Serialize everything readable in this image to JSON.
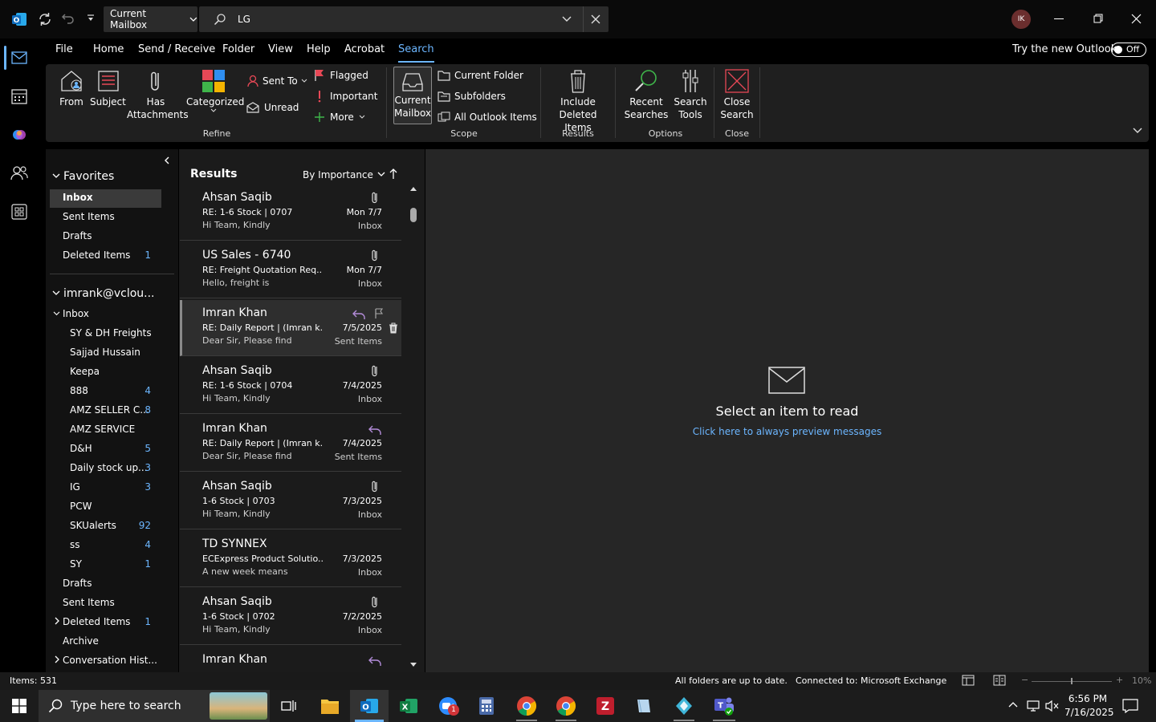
{
  "titlebar": {
    "scope": "Current Mailbox",
    "search_value": "LG",
    "avatar_initials": "IK"
  },
  "menu": {
    "tabs": [
      "File",
      "Home",
      "Send / Receive",
      "Folder",
      "View",
      "Help",
      "Acrobat",
      "Search"
    ],
    "try_new": "Try the new Outlook",
    "toggle": "Off"
  },
  "ribbon": {
    "from": "From",
    "subject": "Subject",
    "has": "Has",
    "attachments": "Attachments",
    "categorized": "Categorized",
    "sent_to": "Sent To",
    "unread": "Unread",
    "flagged": "Flagged",
    "important": "Important",
    "more": "More",
    "refine": "Refine",
    "current": "Current",
    "mailbox": "Mailbox",
    "current_folder": "Current Folder",
    "subfolders": "Subfolders",
    "all_outlook": "All Outlook Items",
    "scope": "Scope",
    "include": "Include",
    "deleted_items": "Deleted Items",
    "results": "Results",
    "recent": "Recent",
    "searches": "Searches",
    "search": "Search",
    "tools": "Tools",
    "options": "Options",
    "close": "Close",
    "close_search": "Search",
    "close_group": "Close"
  },
  "folders": {
    "favorites": "Favorites",
    "fav_items": [
      {
        "label": "Inbox",
        "count": ""
      },
      {
        "label": "Sent Items",
        "count": ""
      },
      {
        "label": "Drafts",
        "count": ""
      },
      {
        "label": "Deleted Items",
        "count": "1"
      }
    ],
    "account": "imrank@vclou...",
    "inbox": "Inbox",
    "inbox_children": [
      {
        "label": "SY & DH Freights",
        "count": ""
      },
      {
        "label": "Sajjad Hussain",
        "count": ""
      },
      {
        "label": "Keepa",
        "count": ""
      },
      {
        "label": "888",
        "count": "4"
      },
      {
        "label": "AMZ SELLER C...",
        "count": "8"
      },
      {
        "label": "AMZ SERVICE",
        "count": ""
      },
      {
        "label": "D&H",
        "count": "5"
      },
      {
        "label": "Daily stock up...",
        "count": "3"
      },
      {
        "label": "IG",
        "count": "3"
      },
      {
        "label": "PCW",
        "count": ""
      },
      {
        "label": "SKUalerts",
        "count": "92"
      },
      {
        "label": "ss",
        "count": "4"
      },
      {
        "label": "SY",
        "count": "1"
      }
    ],
    "drafts": "Drafts",
    "sent": "Sent Items",
    "deleted": "Deleted Items",
    "deleted_count": "1",
    "archive": "Archive",
    "conversation": "Conversation Hist..."
  },
  "list": {
    "title": "Results",
    "sort": "By Importance",
    "messages": [
      {
        "sender": "Ahsan Saqib",
        "subject": "RE: 1-6 Stock | 0707",
        "preview": "Hi Team,  Kindly",
        "date": "Mon 7/7",
        "folder": "Inbox"
      },
      {
        "sender": "US Sales - 6740",
        "subject": "RE: Freight Quotation Req...",
        "preview": "Hello, freight is",
        "date": "Mon 7/7",
        "folder": "Inbox"
      },
      {
        "sender": "Imran Khan",
        "subject": "RE:  Daily Report | (Imran k...",
        "preview": "Dear Sir,  Please find",
        "date": "7/5/2025",
        "folder": "Sent Items"
      },
      {
        "sender": "Ahsan Saqib",
        "subject": "RE: 1-6 Stock | 0704",
        "preview": "Hi Team,  Kindly",
        "date": "7/4/2025",
        "folder": "Inbox"
      },
      {
        "sender": "Imran Khan",
        "subject": "RE:  Daily Report | (Imran k...",
        "preview": "Dear Sir,  Please find",
        "date": "7/4/2025",
        "folder": "Sent Items"
      },
      {
        "sender": "Ahsan Saqib",
        "subject": "1-6 Stock | 0703",
        "preview": "Hi Team,  Kindly",
        "date": "7/3/2025",
        "folder": "Inbox"
      },
      {
        "sender": "TD SYNNEX",
        "subject": "ECExpress Product Solutio...",
        "preview": "A new week means",
        "date": "7/3/2025",
        "folder": "Inbox"
      },
      {
        "sender": "Ahsan Saqib",
        "subject": "1-6 Stock | 0702",
        "preview": "Hi Team,  Kindly",
        "date": "7/2/2025",
        "folder": "Inbox"
      },
      {
        "sender": "Imran Khan",
        "subject": "",
        "preview": "",
        "date": "",
        "folder": ""
      }
    ]
  },
  "reading": {
    "title": "Select an item to read",
    "link": "Click here to always preview messages"
  },
  "status": {
    "items": "Items: 531",
    "sync": "All folders are up to date.",
    "connected": "Connected to: Microsoft Exchange",
    "zoom": "10%"
  },
  "taskbar": {
    "search_placeholder": "Type here to search",
    "time": "6:56 PM",
    "date": "7/16/2025",
    "zoom_badge": "1"
  },
  "colors": {
    "accent": "#6cb6ff",
    "outlook_blue": "#0f6cbd",
    "flag_red": "#e74856",
    "reply_purple": "#b38cd9"
  }
}
